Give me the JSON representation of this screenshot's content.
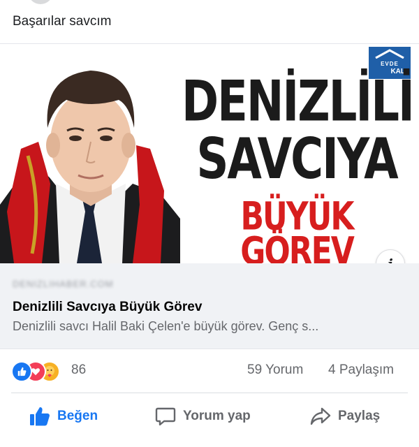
{
  "post": {
    "text": "Başarılar savcım"
  },
  "link_card": {
    "banner": {
      "line1": "DENİZLİLİ",
      "line2": "SAVCIYA",
      "line3": "BÜYÜK GÖREV",
      "logo_line1": "EVDE",
      "logo_line2": "KAL",
      "accent_color": "#d71e1e"
    },
    "info_label": "i",
    "domain": "DENIZLIHABER.COM",
    "title": "Denizlili Savcıya Büyük Görev",
    "description": "Denizlili savcı Halil Baki Çelen'e büyük görev. Genç s..."
  },
  "reactions": {
    "icons": [
      "like-icon",
      "love-icon",
      "care-icon"
    ],
    "count": "86",
    "comments": "59 Yorum",
    "shares": "4 Paylaşım"
  },
  "actions": {
    "like": "Beğen",
    "comment": "Yorum yap",
    "share": "Paylaş",
    "like_color": "#1877f2"
  }
}
